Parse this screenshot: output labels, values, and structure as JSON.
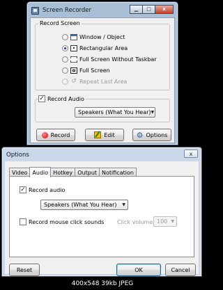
{
  "screen_recorder": {
    "title": "Screen Recorder",
    "caption_buttons": {
      "minimize": "▁",
      "maximize": "□",
      "close": "x"
    },
    "record_screen_group": {
      "label": "Record Screen",
      "options": [
        {
          "label": "Window / Object",
          "icon": "window-icon",
          "selected": false,
          "enabled": true
        },
        {
          "label": "Rectangular Area",
          "icon": "rectangle-icon",
          "selected": true,
          "enabled": true
        },
        {
          "label": "Full Screen Without Taskbar",
          "icon": "screen-without-taskbar-icon",
          "selected": false,
          "enabled": true
        },
        {
          "label": "Full Screen",
          "icon": "full-screen-icon",
          "selected": false,
          "enabled": true
        },
        {
          "label": "Repeat Last Area",
          "icon": "repeat-icon",
          "selected": false,
          "enabled": false
        }
      ],
      "repeat_glyph": "↺"
    },
    "record_audio_group": {
      "checkbox_label": "Record Audio",
      "checked": true,
      "check_glyph": "✓",
      "source": "Speakers (What You Hear)"
    },
    "buttons": {
      "record": "Record",
      "edit": "Edit",
      "options": "Options"
    },
    "gear_glyph": "⚙"
  },
  "options_dialog": {
    "title": "Options",
    "close_glyph": "x",
    "tabs": [
      {
        "label": "Video",
        "active": false
      },
      {
        "label": "Audio",
        "active": true
      },
      {
        "label": "Hotkey",
        "active": false
      },
      {
        "label": "Output",
        "active": false
      },
      {
        "label": "Notification",
        "active": false
      }
    ],
    "audio": {
      "record_audio_label": "Record audio",
      "record_audio_checked": true,
      "source": "Speakers (What You Hear)",
      "mouse_click_label": "Record mouse click sounds",
      "mouse_click_checked": false,
      "click_volume_label": "Click volume:",
      "click_volume_value": "100"
    },
    "buttons": {
      "reset": "Reset",
      "ok": "OK",
      "cancel": "Cancel"
    }
  },
  "dropdown_arrow": "▼",
  "footer_caption": "400x548  39kb  JPEG"
}
